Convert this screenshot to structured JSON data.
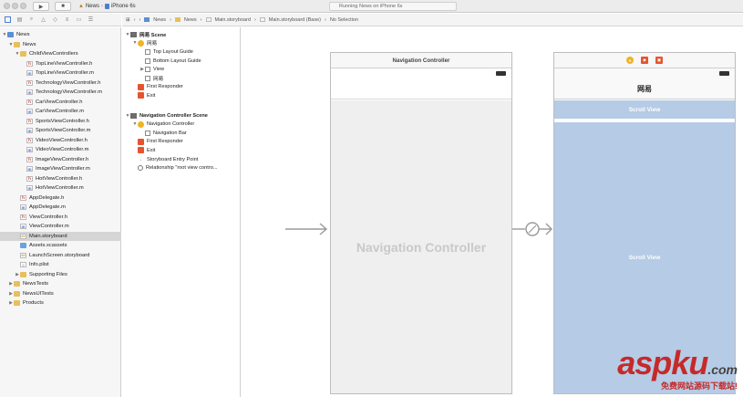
{
  "toolbar": {
    "scheme": "News",
    "device": "iPhone 6s",
    "status": "Running News on iPhone 6s"
  },
  "jumpbar": {
    "crumbs": [
      "News",
      "News",
      "Main.storyboard",
      "Main.storyboard (Base)",
      "No Selection"
    ]
  },
  "navigator": {
    "items": [
      {
        "label": "News",
        "depth": 0,
        "type": "project",
        "open": true
      },
      {
        "label": "News",
        "depth": 1,
        "type": "folder",
        "open": true
      },
      {
        "label": "ChildViewControllers",
        "depth": 2,
        "type": "folder",
        "open": true
      },
      {
        "label": "TopLineViewController.h",
        "depth": 3,
        "type": "h"
      },
      {
        "label": "TopLineViewController.m",
        "depth": 3,
        "type": "m"
      },
      {
        "label": "TechnologyViewController.h",
        "depth": 3,
        "type": "h"
      },
      {
        "label": "TechnologyViewController.m",
        "depth": 3,
        "type": "m"
      },
      {
        "label": "CarViewController.h",
        "depth": 3,
        "type": "h"
      },
      {
        "label": "CarViewController.m",
        "depth": 3,
        "type": "m"
      },
      {
        "label": "SportsViewController.h",
        "depth": 3,
        "type": "h"
      },
      {
        "label": "SportsViewController.m",
        "depth": 3,
        "type": "m"
      },
      {
        "label": "VideoViewController.h",
        "depth": 3,
        "type": "h"
      },
      {
        "label": "VideoViewController.m",
        "depth": 3,
        "type": "m"
      },
      {
        "label": "ImageViewController.h",
        "depth": 3,
        "type": "h"
      },
      {
        "label": "ImageViewController.m",
        "depth": 3,
        "type": "m"
      },
      {
        "label": "HotViewController.h",
        "depth": 3,
        "type": "h"
      },
      {
        "label": "HotViewController.m",
        "depth": 3,
        "type": "m"
      },
      {
        "label": "AppDelegate.h",
        "depth": 2,
        "type": "h"
      },
      {
        "label": "AppDelegate.m",
        "depth": 2,
        "type": "m"
      },
      {
        "label": "ViewController.h",
        "depth": 2,
        "type": "h"
      },
      {
        "label": "ViewController.m",
        "depth": 2,
        "type": "m"
      },
      {
        "label": "Main.storyboard",
        "depth": 2,
        "type": "storyboard",
        "selected": true
      },
      {
        "label": "Assets.xcassets",
        "depth": 2,
        "type": "assets"
      },
      {
        "label": "LaunchScreen.storyboard",
        "depth": 2,
        "type": "storyboard"
      },
      {
        "label": "Info.plist",
        "depth": 2,
        "type": "plist"
      },
      {
        "label": "Supporting Files",
        "depth": 2,
        "type": "folder",
        "open": false
      },
      {
        "label": "NewsTests",
        "depth": 1,
        "type": "folder",
        "open": false
      },
      {
        "label": "NewsUITests",
        "depth": 1,
        "type": "folder",
        "open": false
      },
      {
        "label": "Products",
        "depth": 1,
        "type": "folder",
        "open": false
      }
    ]
  },
  "outline": {
    "items": [
      {
        "label": "网易 Scene",
        "depth": 0,
        "type": "scene",
        "open": true
      },
      {
        "label": "网易",
        "depth": 1,
        "type": "vc",
        "open": true
      },
      {
        "label": "Top Layout Guide",
        "depth": 2,
        "type": "box"
      },
      {
        "label": "Bottom Layout Guide",
        "depth": 2,
        "type": "box"
      },
      {
        "label": "View",
        "depth": 2,
        "type": "box",
        "open": false
      },
      {
        "label": "网易",
        "depth": 2,
        "type": "box"
      },
      {
        "label": "First Responder",
        "depth": 1,
        "type": "responder"
      },
      {
        "label": "Exit",
        "depth": 1,
        "type": "exit"
      },
      {
        "label": "Navigation Controller Scene",
        "depth": 0,
        "type": "scene",
        "open": true
      },
      {
        "label": "Navigation Controller",
        "depth": 1,
        "type": "vc",
        "open": true
      },
      {
        "label": "Navigation Bar",
        "depth": 2,
        "type": "box"
      },
      {
        "label": "First Responder",
        "depth": 1,
        "type": "responder"
      },
      {
        "label": "Exit",
        "depth": 1,
        "type": "exit"
      },
      {
        "label": "Storyboard Entry Point",
        "depth": 1,
        "type": "arrow"
      },
      {
        "label": "Relationship \"root view contro...",
        "depth": 1,
        "type": "circle"
      }
    ]
  },
  "canvas": {
    "nav_controller_title": "Navigation Controller",
    "nav_controller_body": "Navigation Controller",
    "vc_nav_title": "网易",
    "scroll_view_top": "Scroll View",
    "scroll_view_main": "Scroll View"
  },
  "watermark": {
    "brand": "aspku",
    "tld": ".com",
    "tagline": "免费网站源码下载站!"
  }
}
